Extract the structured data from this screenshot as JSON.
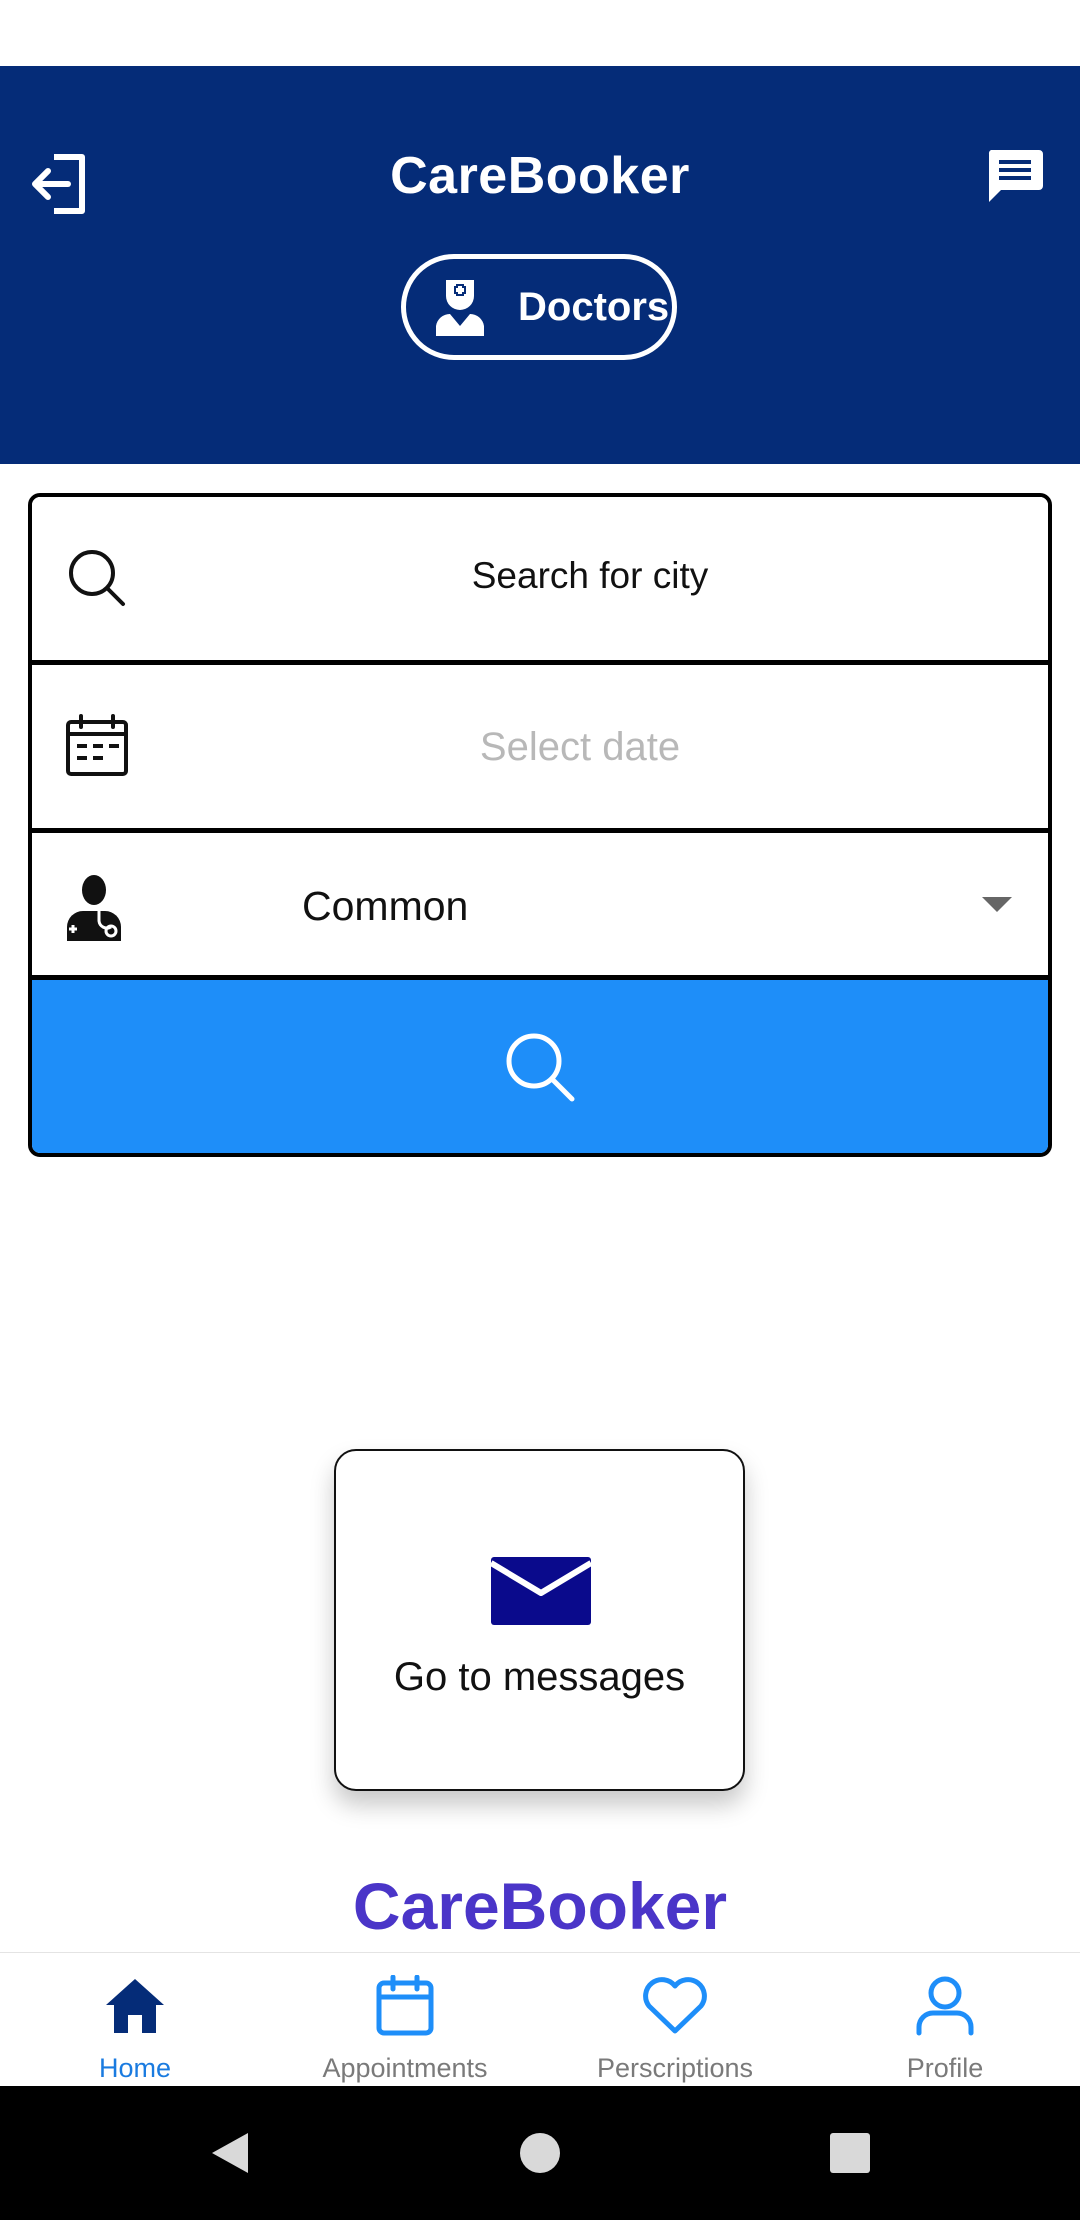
{
  "header": {
    "title": "CareBooker",
    "logout_icon": "logout-icon",
    "messages_icon": "chat-icon",
    "mode_toggle": {
      "label": "Doctors",
      "icon": "doctor-icon"
    }
  },
  "search_form": {
    "city": {
      "icon": "search-icon",
      "value": "Search for city"
    },
    "date": {
      "icon": "calendar-icon",
      "placeholder": "Select date"
    },
    "specialty": {
      "icon": "physician-icon",
      "selected": "Common"
    },
    "submit_icon": "search-icon"
  },
  "messages_card": {
    "icon": "envelope-icon",
    "label": "Go to messages"
  },
  "brand_footer": "CareBooker",
  "bottom_nav": {
    "active": "Home",
    "items": [
      {
        "label": "Home",
        "icon": "home-icon"
      },
      {
        "label": "Appointments",
        "icon": "calendar-icon"
      },
      {
        "label": "Perscriptions",
        "icon": "heart-icon"
      },
      {
        "label": "Profile",
        "icon": "user-icon"
      }
    ]
  },
  "system_nav": [
    "back",
    "home",
    "recents"
  ],
  "colors": {
    "header_bg": "#052c78",
    "accent_button": "#1e8ef9",
    "brand_text": "#4a35c8",
    "nav_active": "#052c78",
    "nav_inactive_icon": "#1e8ef9",
    "nav_active_label": "#1a7be0",
    "envelope": "#0a0a8c"
  }
}
